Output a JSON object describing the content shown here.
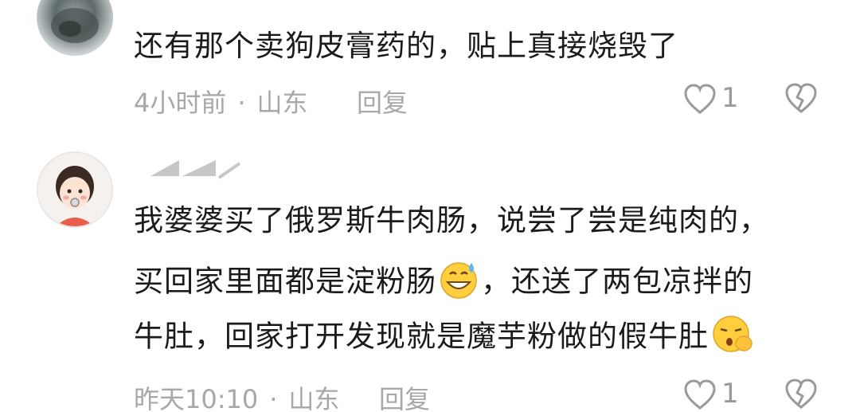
{
  "comments": [
    {
      "text_lines": [
        "还有那个卖狗皮膏药的，贴上真接烧毁了"
      ],
      "time": "4小时前",
      "location": "山东",
      "reply_label": "回复",
      "likes": "1"
    },
    {
      "text_lines": [
        "我婆婆买了俄罗斯牛肉肠，说尝了尝是纯肉的，",
        "买回家里面都是淀粉肠",
        "，还送了两包凉拌的",
        "牛肚，回家打开发现就是魔芋粉做的假牛肚"
      ],
      "time": "昨天10:10",
      "location": "山东",
      "reply_label": "回复",
      "likes": "1",
      "emojis": [
        "sweat-smile-emoji",
        "shush-emoji"
      ]
    }
  ],
  "separator": "·",
  "colors": {
    "text": "#1b1b1b",
    "meta": "#a8a8a8",
    "icon": "#9a9a9a"
  }
}
